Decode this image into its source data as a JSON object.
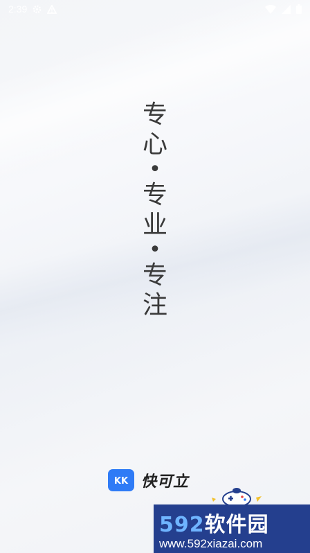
{
  "status_bar": {
    "time": "2:39",
    "icons": [
      "settings-gear-icon",
      "warning-triangle-icon",
      "wifi-icon",
      "signal-icon",
      "battery-icon"
    ]
  },
  "slogan": {
    "chars": [
      "专",
      "心",
      "•",
      "专",
      "业",
      "•",
      "专",
      "注"
    ]
  },
  "brand": {
    "logo_text": "KK",
    "name": "快可立",
    "accent_color": "#2f7bf6"
  },
  "watermark": {
    "title_num": "592",
    "title_text": "软件园",
    "url": "www.592xiazai.com",
    "bg_color": "#243f8e"
  }
}
